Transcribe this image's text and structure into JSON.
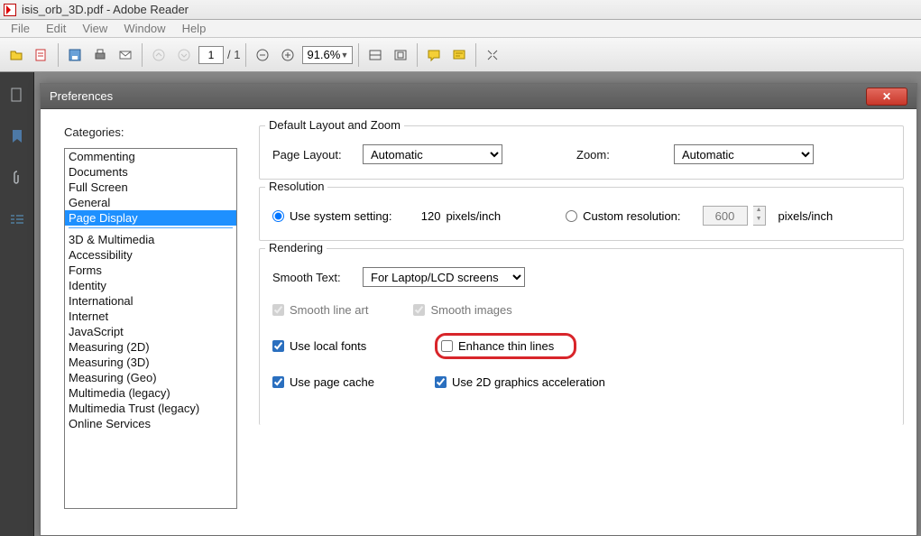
{
  "titlebar": {
    "title": "isis_orb_3D.pdf - Adobe Reader"
  },
  "menubar": {
    "items": [
      "File",
      "Edit",
      "View",
      "Window",
      "Help"
    ]
  },
  "toolbar": {
    "page_current": "1",
    "page_sep": "/ 1",
    "zoom": "91.6%"
  },
  "dialog": {
    "title": "Preferences",
    "categories_label": "Categories:",
    "categories": [
      "Commenting",
      "Documents",
      "Full Screen",
      "General",
      "Page Display",
      "",
      "3D & Multimedia",
      "Accessibility",
      "Forms",
      "Identity",
      "International",
      "Internet",
      "JavaScript",
      "Measuring (2D)",
      "Measuring (3D)",
      "Measuring (Geo)",
      "Multimedia (legacy)",
      "Multimedia Trust (legacy)",
      "Online Services"
    ],
    "selected_category_index": 4,
    "layout_group": {
      "label": "Default Layout and Zoom",
      "page_layout_label": "Page Layout:",
      "page_layout_value": "Automatic",
      "zoom_label": "Zoom:",
      "zoom_value": "Automatic"
    },
    "resolution_group": {
      "label": "Resolution",
      "use_system_label": "Use system setting:",
      "use_system_value": "120",
      "unit": "pixels/inch",
      "custom_label": "Custom resolution:",
      "custom_value": "600"
    },
    "rendering_group": {
      "label": "Rendering",
      "smooth_text_label": "Smooth Text:",
      "smooth_text_value": "For Laptop/LCD screens",
      "cb_smooth_line": "Smooth line art",
      "cb_smooth_images": "Smooth images",
      "cb_local_fonts": "Use local fonts",
      "cb_enhance_thin": "Enhance thin lines",
      "cb_page_cache": "Use page cache",
      "cb_2d_accel": "Use 2D graphics acceleration"
    }
  }
}
